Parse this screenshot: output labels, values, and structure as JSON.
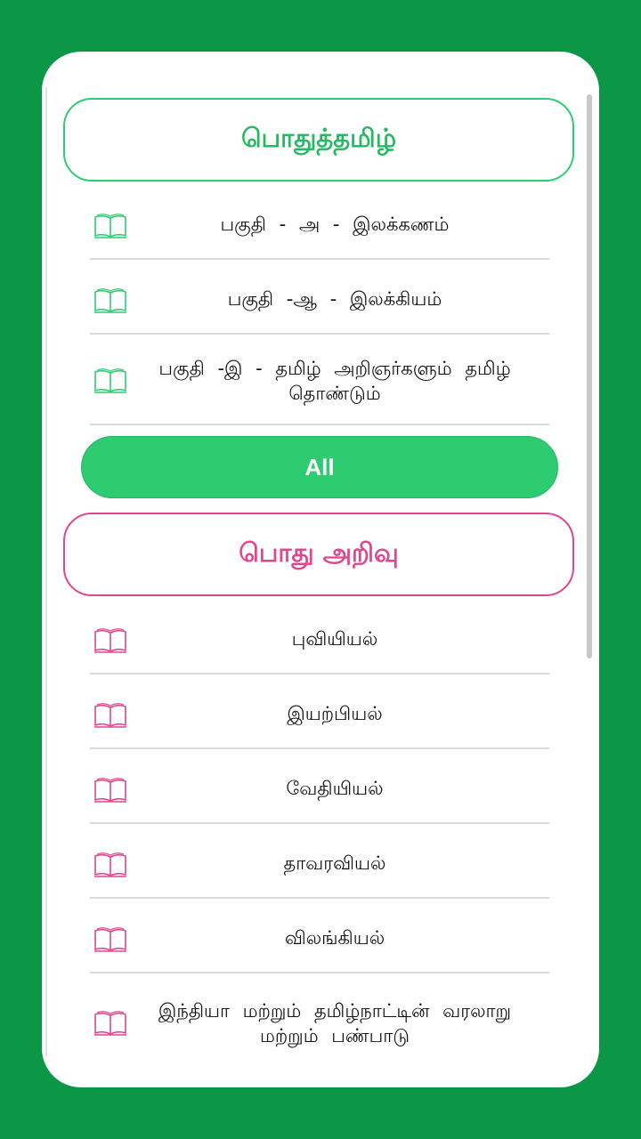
{
  "colors": {
    "background": "#0c9747",
    "green_accent": "#2ecc71",
    "pink_accent": "#e0458e"
  },
  "sections": [
    {
      "title": "பொதுத்தமிழ்",
      "icon": "open-book-icon",
      "items": [
        {
          "label": "பகுதி - அ - இலக்கணம்"
        },
        {
          "label": "பகுதி -ஆ - இலக்கியம்"
        },
        {
          "label": "பகுதி -இ - தமிழ் அறிஞர்களும் தமிழ் தொண்டும்"
        }
      ],
      "all_button": "All"
    },
    {
      "title": "பொது அறிவு",
      "icon": "open-book-icon",
      "items": [
        {
          "label": "புவியியல்"
        },
        {
          "label": "இயற்பியல்"
        },
        {
          "label": "வேதியியல்"
        },
        {
          "label": "தாவரவியல்"
        },
        {
          "label": "விலங்கியல்"
        },
        {
          "label": "இந்தியா மற்றும் தமிழ்நாட்டின் வரலாறு மற்றும் பண்பாடு"
        }
      ]
    }
  ]
}
